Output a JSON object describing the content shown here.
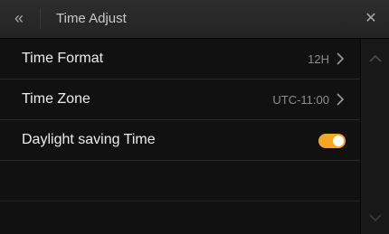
{
  "header": {
    "title": "Time Adjust",
    "back_icon": "double-chevron-left-icon",
    "close_icon": "close-icon"
  },
  "settings": [
    {
      "label": "Time Format",
      "value": "12H",
      "type": "link"
    },
    {
      "label": "Time Zone",
      "value": "UTC-11:00",
      "type": "link"
    },
    {
      "label": "Daylight saving Time",
      "value": "",
      "type": "toggle",
      "enabled": true
    }
  ],
  "colors": {
    "accent": "#f5a623",
    "background": "#111111",
    "header": "#2a2a2a"
  }
}
